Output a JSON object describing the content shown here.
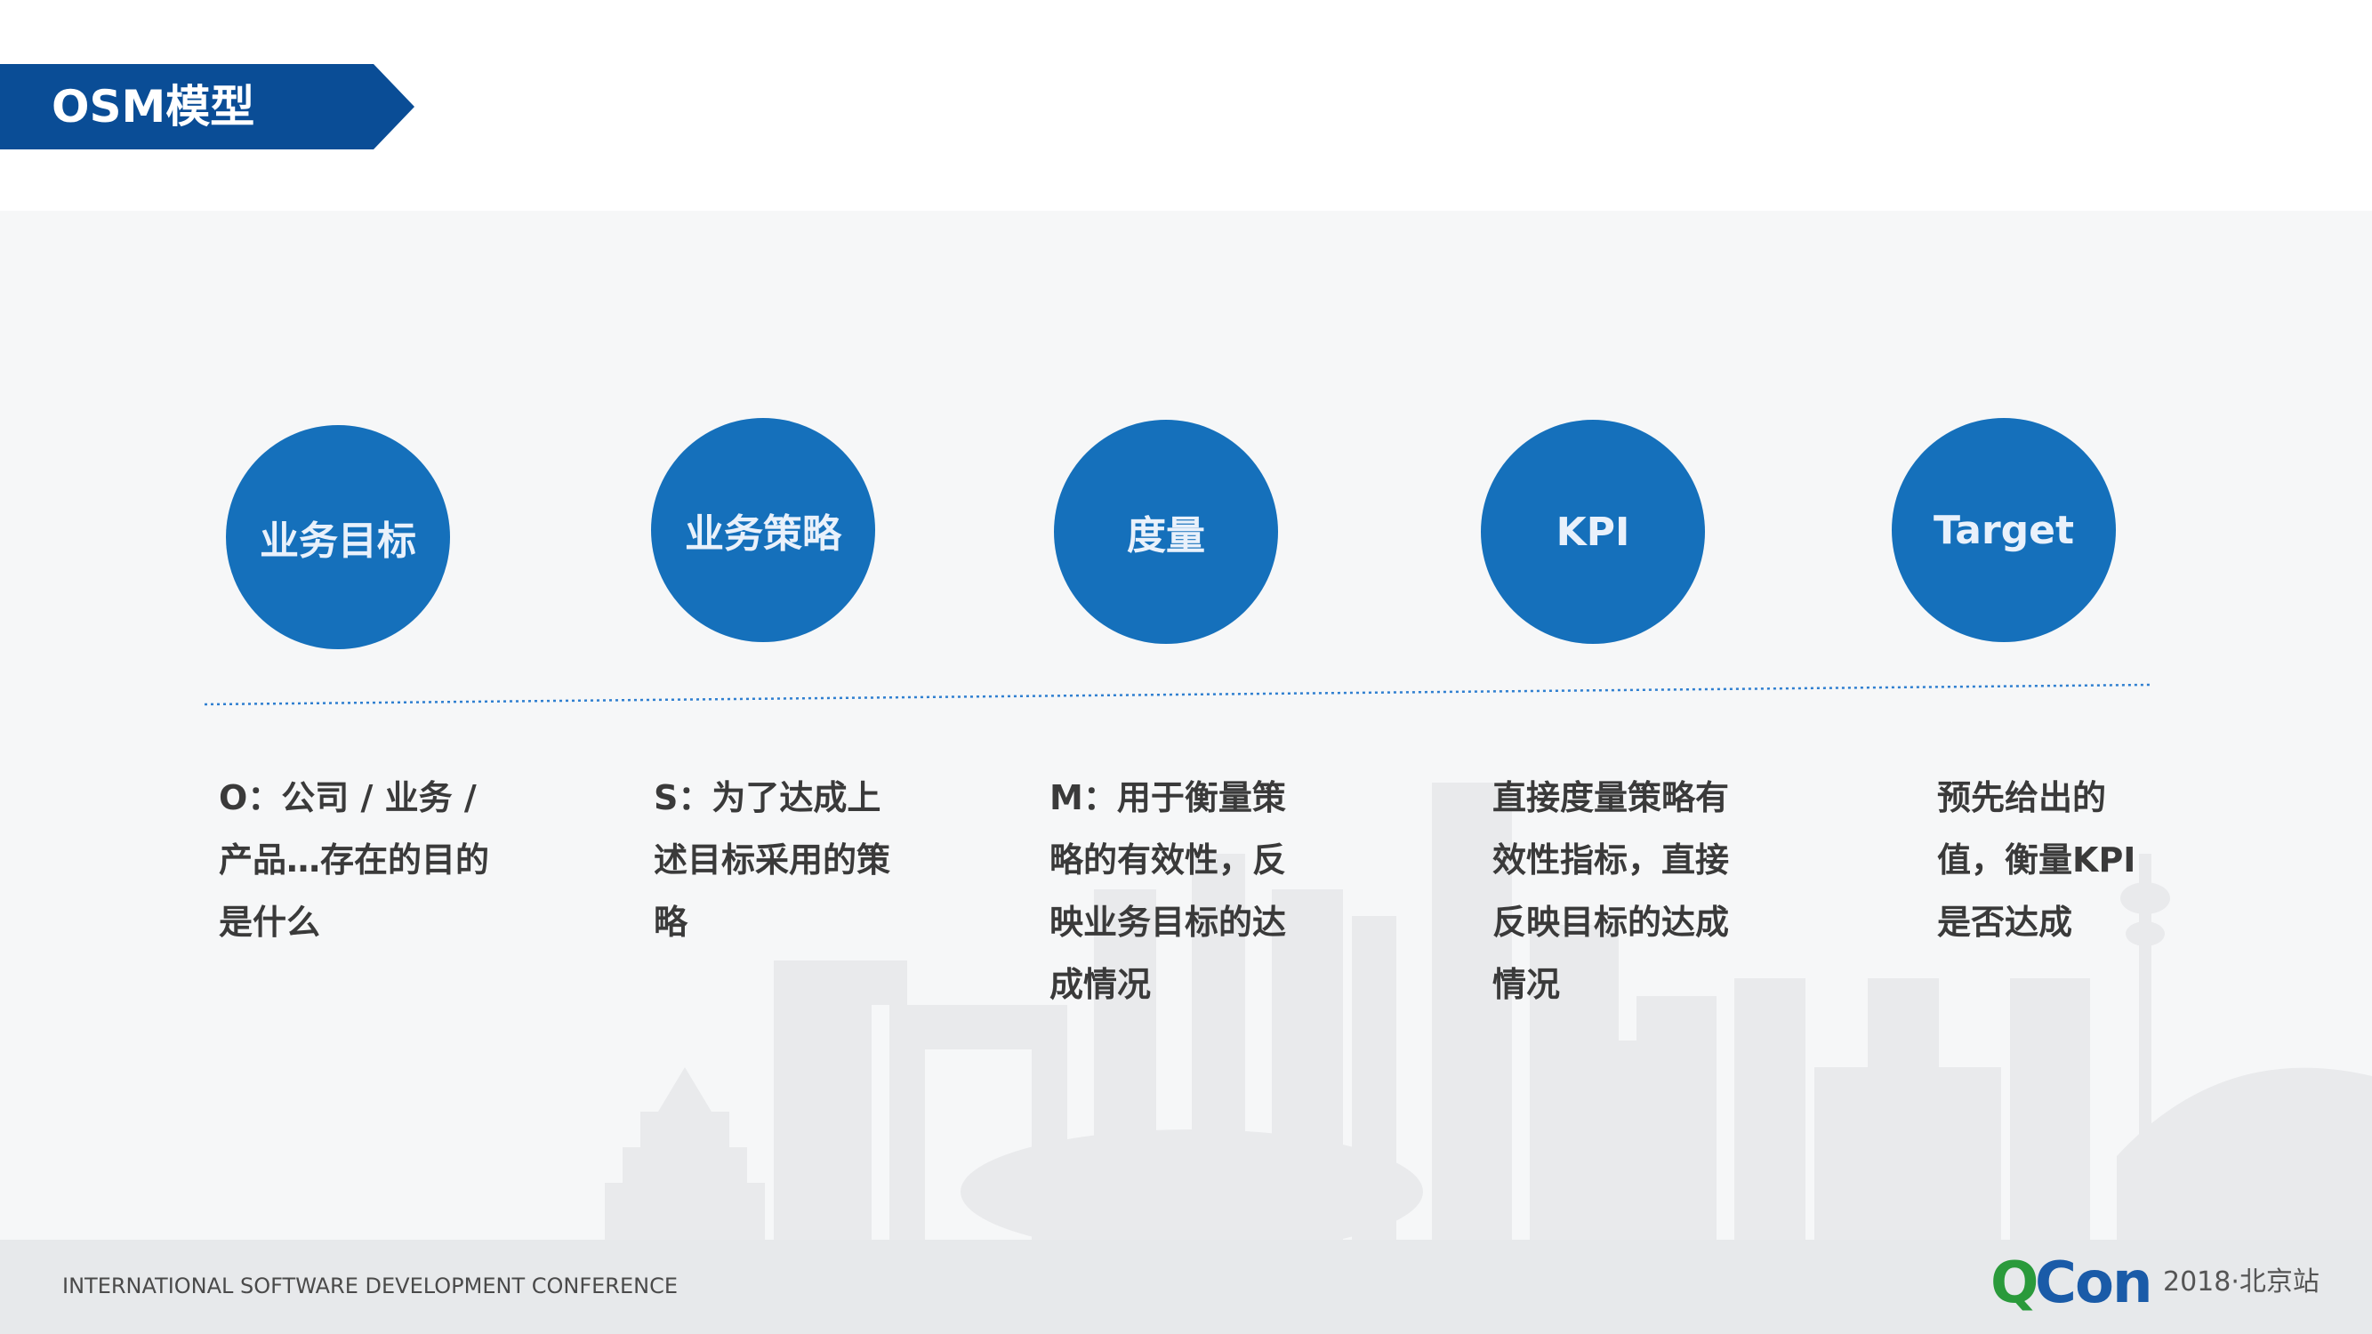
{
  "page_title": "OSM模型",
  "stages": [
    {
      "label": "业务目标",
      "desc": [
        "O：公司 / 业务 /",
        "产品…存在的目的",
        "是什么"
      ]
    },
    {
      "label": "业务策略",
      "desc": [
        "S：为了达成上",
        "述目标采用的策",
        "略"
      ]
    },
    {
      "label": "度量",
      "desc": [
        "M：用于衡量策",
        "略的有效性，反",
        "映业务目标的达",
        "成情况"
      ]
    },
    {
      "label": "KPI",
      "desc": [
        "直接度量策略有",
        "效性指标，直接",
        "反映目标的达成",
        "情况"
      ]
    },
    {
      "label": "Target",
      "desc": [
        "预先给出的",
        "值，衡量KPI",
        "是否达成"
      ]
    }
  ],
  "footer": {
    "conference": "INTERNATIONAL SOFTWARE DEVELOPMENT CONFERENCE",
    "logo_q": "Q",
    "logo_con": "Con",
    "edition": "2018·北京站"
  },
  "colors": {
    "banner": "#0a4d96",
    "circle": "#1570bb",
    "dotted_line": "#2f7fd0",
    "logo_green": "#2a9a3b",
    "logo_blue": "#1a5ba8"
  }
}
